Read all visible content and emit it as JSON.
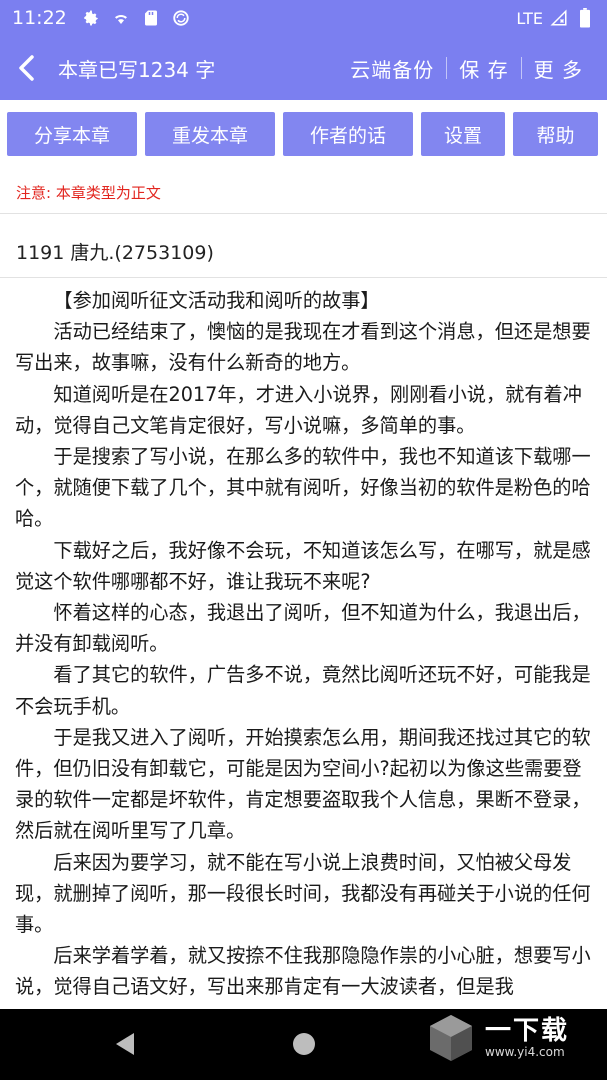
{
  "status_bar": {
    "time": "11:22",
    "network": "LTE",
    "icons": [
      "gear-icon",
      "wifi-icon",
      "sd-card-icon",
      "sync-icon",
      "signal-icon",
      "battery-icon"
    ]
  },
  "app_bar": {
    "title": "本章已写1234 字",
    "actions": [
      "云端备份",
      "保 存",
      "更 多"
    ]
  },
  "toolbar": {
    "buttons": [
      "分享本章",
      "重发本章",
      "作者的话",
      "设置",
      "帮助"
    ]
  },
  "notice": "注意: 本章类型为正文",
  "chapter_title": "1191 唐九.(2753109)",
  "content": {
    "heading": "【参加阅听征文活动我和阅听的故事】",
    "paragraphs": [
      "活动已经结束了，懊恼的是我现在才看到这个消息，但还是想要写出来，故事嘛，没有什么新奇的地方。",
      "知道阅听是在2017年，才进入小说界，刚刚看小说，就有着冲动，觉得自己文笔肯定很好，写小说嘛，多简单的事。",
      "于是搜索了写小说，在那么多的软件中，我也不知道该下载哪一个，就随便下载了几个，其中就有阅听，好像当初的软件是粉色的哈哈。",
      "下载好之后，我好像不会玩，不知道该怎么写，在哪写，就是感觉这个软件哪哪都不好，谁让我玩不来呢?",
      "怀着这样的心态，我退出了阅听，但不知道为什么，我退出后，并没有卸载阅听。",
      "看了其它的软件，广告多不说，竟然比阅听还玩不好，可能我是不会玩手机。",
      "于是我又进入了阅听，开始摸索怎么用，期间我还找过其它的软件，但仍旧没有卸载它，可能是因为空间小?起初以为像这些需要登录的软件一定都是坏软件，肯定想要盗取我个人信息，果断不登录，然后就在阅听里写了几章。",
      "后来因为要学习，就不能在写小说上浪费时间，又怕被父母发现，就删掉了阅听，那一段很长时间，我都没有再碰关于小说的任何事。",
      "后来学着学着，就又按捺不住我那隐隐作祟的小心脏，想要写小说，觉得自己语文好，写出来那肯定有一大波读者，但是我"
    ]
  },
  "watermark": {
    "brand": "一下载",
    "url": "www.yi4.com"
  }
}
